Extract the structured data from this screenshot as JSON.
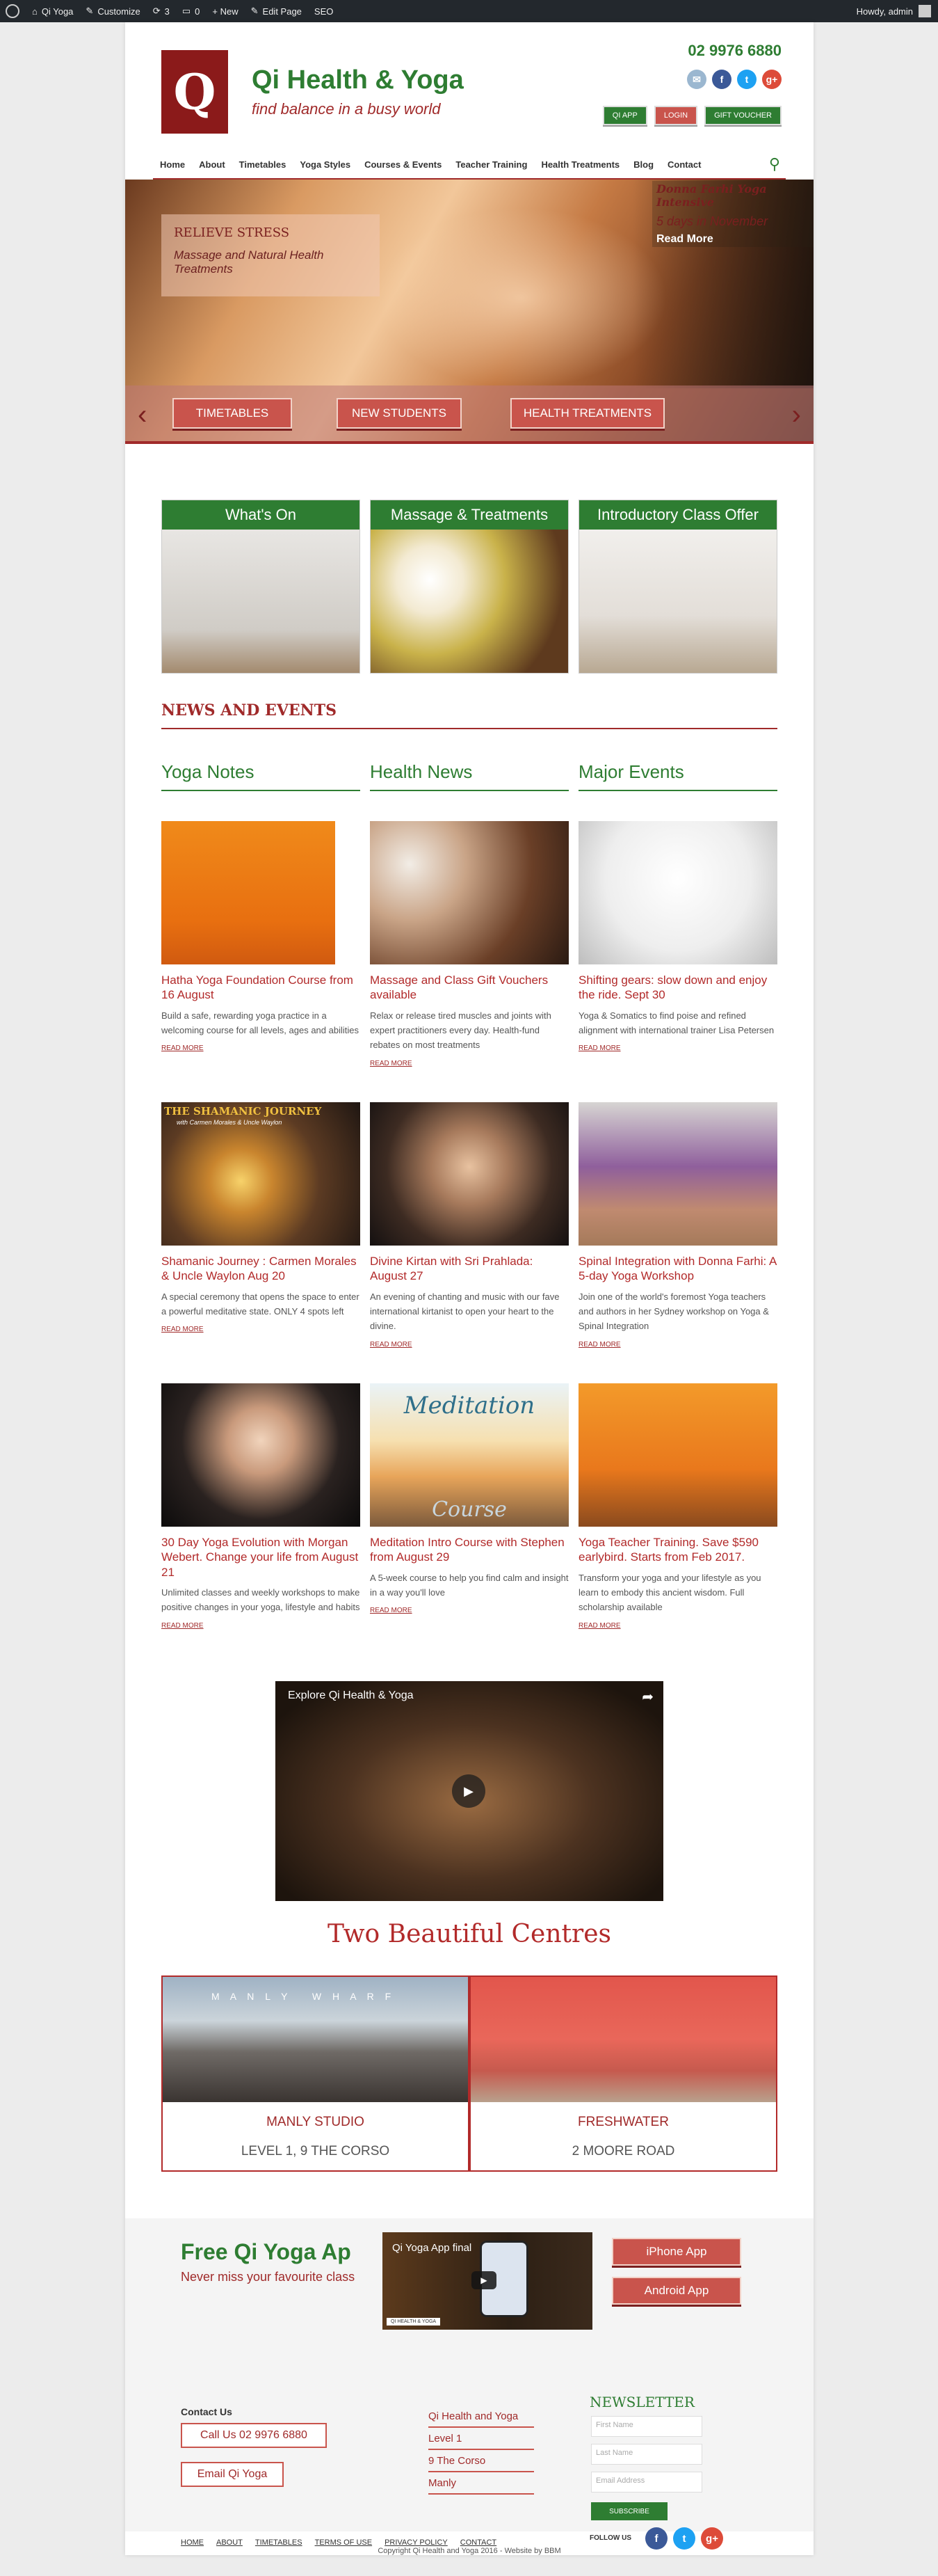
{
  "admin_bar": {
    "site_name": "Qi Yoga",
    "customize": "Customize",
    "updates": "3",
    "comments": "0",
    "new": "+ New",
    "edit_page": "Edit Page",
    "seo": "SEO",
    "howdy": "Howdy, admin"
  },
  "header": {
    "logo_letter": "Q",
    "title": "Qi Health & Yoga",
    "tagline": "find balance in a busy world",
    "phone": "02 9976 6880",
    "social": [
      "email-icon",
      "facebook-icon",
      "twitter-icon",
      "google-plus-icon"
    ],
    "buttons": {
      "qi_app": "Qi App",
      "login": "Login",
      "gift_voucher": "Gift Voucher"
    }
  },
  "nav": {
    "items": [
      "Home",
      "About",
      "Timetables",
      "Yoga Styles",
      "Courses & Events",
      "Teacher Training",
      "Health Treatments",
      "Blog",
      "Contact"
    ],
    "search_icon": "search-icon"
  },
  "hero": {
    "title": "Relieve Stress",
    "subtitle": "Massage and Natural Health Treatments",
    "event_title": "Donna Farhi Yoga Intensive",
    "event_days": "5 days in November",
    "event_more": "Read More",
    "buttons": [
      "Timetables",
      "New Students",
      "Health Treatments"
    ]
  },
  "features": [
    "What's On",
    "Massage & Treatments",
    "Introductory Class Offer"
  ],
  "news": {
    "heading": "News and Events",
    "columns": [
      "Yoga Notes",
      "Health News",
      "Major Events"
    ],
    "read_more": "Read More",
    "cards": [
      {
        "title": "Hatha Yoga Foundation Course from 16 August",
        "excerpt": "Build a safe, rewarding yoga practice in a welcoming course for all levels, ages and abilities"
      },
      {
        "title": "Massage and Class Gift Vouchers available",
        "excerpt": "Relax or release tired muscles and joints with expert practitioners every day. Health-fund rebates on most treatments"
      },
      {
        "title": "Shifting gears: slow down and enjoy the ride. Sept 30",
        "excerpt": "Yoga & Somatics to find poise and refined alignment with international trainer Lisa Petersen"
      },
      {
        "title": "Shamanic Journey : Carmen Morales & Uncle Waylon Aug 20",
        "excerpt": "A special ceremony that opens the space to enter a powerful meditative state. ONLY 4 spots left"
      },
      {
        "title": "Divine Kirtan with Sri Prahlada: August 27",
        "excerpt": "An evening of chanting and music with our fave international kirtanist to open your heart to the divine."
      },
      {
        "title": "Spinal Integration with Donna Farhi: A 5-day Yoga Workshop",
        "excerpt": "Join one of the world's foremost Yoga teachers and authors in her Sydney workshop on Yoga & Spinal Integration"
      },
      {
        "title": "30 Day Yoga Evolution with Morgan Webert. Change your life from August 21",
        "excerpt": "Unlimited classes and weekly workshops to make positive changes in your yoga, lifestyle and habits"
      },
      {
        "title": "Meditation Intro Course with Stephen from August 29",
        "excerpt": "A 5-week course to help you find calm and insight in a way you'll love"
      },
      {
        "title": "Yoga Teacher Training. Save $590 earlybird. Starts from Feb 2017.",
        "excerpt": "Transform your yoga and your lifestyle as you learn to embody this ancient wisdom. Full scholarship available"
      }
    ],
    "image_texts": {
      "shamanic": "THE SHAMANIC JOURNEY",
      "shamanic_sub": "with Carmen Morales & Uncle Waylon",
      "meditation": "Meditation",
      "course": "Course"
    }
  },
  "video": {
    "title": "Explore Qi Health & Yoga"
  },
  "centres": {
    "heading": "Two Beautiful Centres",
    "items": [
      {
        "name": "Manly Studio",
        "address": "Level 1, 9 The Corso",
        "sign": "M A N L Y   W H A R F"
      },
      {
        "name": "Freshwater",
        "address": "2 Moore Road"
      }
    ]
  },
  "app": {
    "title": "Free Qi Yoga Ap",
    "subtitle": "Never miss your favourite class",
    "video_title": "Qi Yoga App final",
    "video_caption": "QI HEALTH & YOGA",
    "iphone": "iPhone App",
    "android": "Android App"
  },
  "footer": {
    "contact_heading": "Contact Us",
    "call": "Call Us 02 9976 6880",
    "email": "Email Qi Yoga",
    "locations": [
      "Qi Health and Yoga",
      "Level 1",
      "9 The Corso",
      "Manly"
    ],
    "newsletter_heading": "Newsletter",
    "first_name": "First Name",
    "last_name": "Last Name",
    "email_address": "Email Address",
    "subscribe": "Subscribe",
    "follow": "Follow Us",
    "links": [
      "Home",
      "About",
      "Timetables",
      "Terms of Use",
      "Privacy Policy",
      "Contact"
    ],
    "copyright": "Copyright Qi Health and Yoga 2016 - Website by BBM"
  },
  "colors": {
    "brand_green": "#2e7d32",
    "brand_red": "#a02a2a",
    "button_red": "#c9544c"
  }
}
